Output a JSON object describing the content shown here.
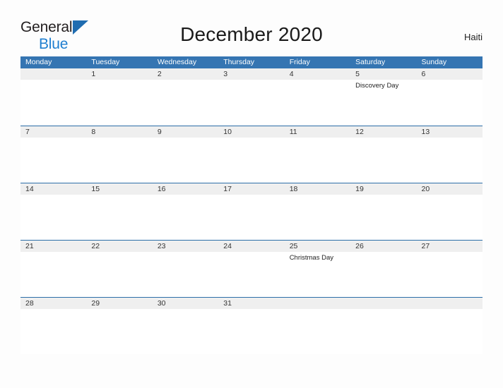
{
  "brand": {
    "name_part1": "General",
    "name_part2": "Blue",
    "sail_icon": "sail-triangle-icon",
    "accent_color": "#1f7fd0"
  },
  "header": {
    "title": "December 2020",
    "country": "Haiti"
  },
  "theme": {
    "header_blue": "#3575b2",
    "row_border_blue": "#2c6ea8",
    "band_gray": "#efefef",
    "page_background": "#fdfdfd"
  },
  "calendar": {
    "month": "December",
    "year": "2020",
    "weekday_headers": [
      "Monday",
      "Tuesday",
      "Wednesday",
      "Thursday",
      "Friday",
      "Saturday",
      "Sunday"
    ],
    "weeks": [
      [
        {
          "day": "",
          "event": ""
        },
        {
          "day": "1",
          "event": ""
        },
        {
          "day": "2",
          "event": ""
        },
        {
          "day": "3",
          "event": ""
        },
        {
          "day": "4",
          "event": ""
        },
        {
          "day": "5",
          "event": "Discovery Day"
        },
        {
          "day": "6",
          "event": ""
        }
      ],
      [
        {
          "day": "7",
          "event": ""
        },
        {
          "day": "8",
          "event": ""
        },
        {
          "day": "9",
          "event": ""
        },
        {
          "day": "10",
          "event": ""
        },
        {
          "day": "11",
          "event": ""
        },
        {
          "day": "12",
          "event": ""
        },
        {
          "day": "13",
          "event": ""
        }
      ],
      [
        {
          "day": "14",
          "event": ""
        },
        {
          "day": "15",
          "event": ""
        },
        {
          "day": "16",
          "event": ""
        },
        {
          "day": "17",
          "event": ""
        },
        {
          "day": "18",
          "event": ""
        },
        {
          "day": "19",
          "event": ""
        },
        {
          "day": "20",
          "event": ""
        }
      ],
      [
        {
          "day": "21",
          "event": ""
        },
        {
          "day": "22",
          "event": ""
        },
        {
          "day": "23",
          "event": ""
        },
        {
          "day": "24",
          "event": ""
        },
        {
          "day": "25",
          "event": "Christmas Day"
        },
        {
          "day": "26",
          "event": ""
        },
        {
          "day": "27",
          "event": ""
        }
      ],
      [
        {
          "day": "28",
          "event": ""
        },
        {
          "day": "29",
          "event": ""
        },
        {
          "day": "30",
          "event": ""
        },
        {
          "day": "31",
          "event": ""
        },
        {
          "day": "",
          "event": ""
        },
        {
          "day": "",
          "event": ""
        },
        {
          "day": "",
          "event": ""
        }
      ]
    ]
  }
}
